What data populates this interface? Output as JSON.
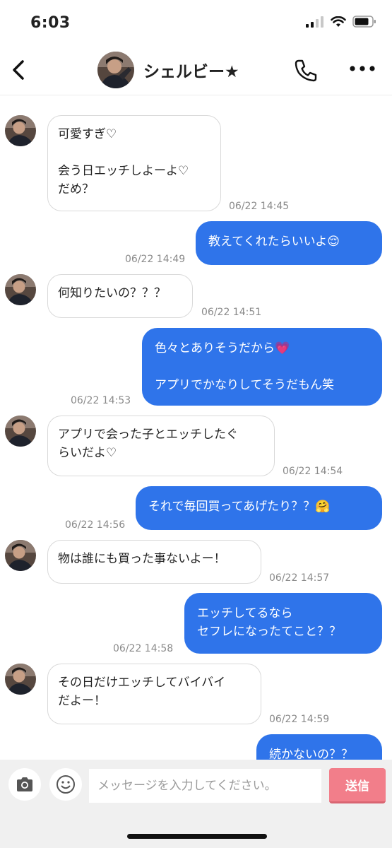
{
  "status": {
    "time": "6:03"
  },
  "header": {
    "name": "シェルビー★"
  },
  "messages": [
    {
      "text": "可愛すぎ♡\n\n会う日エッチしよーよ♡\nだめ？",
      "time": "06/22 14:45"
    },
    {
      "text": "教えてくれたらいいよ😌",
      "time": "06/22 14:49"
    },
    {
      "text": "何知りたいの？？？",
      "time": "06/22 14:51"
    },
    {
      "text": "色々とありそうだから💗\n\nアプリでかなりしてそうだもん笑",
      "time": "06/22 14:53"
    },
    {
      "text": "アプリで会った子とエッチしたぐ\nらいだよ♡",
      "time": "06/22 14:54"
    },
    {
      "text": "それで毎回買ってあげたり？？🤗",
      "time": "06/22 14:56"
    },
    {
      "text": "物は誰にも買った事ないよー！",
      "time": "06/22 14:57"
    },
    {
      "text": "エッチしてるなら\nセフレになったてこと？？",
      "time": "06/22 14:58"
    },
    {
      "text": "その日だけエッチしてバイバイ\nだよー！",
      "time": "06/22 14:59"
    },
    {
      "text": "続かないの？？",
      "time": ""
    }
  ],
  "input": {
    "placeholder": "メッセージを入力してください。",
    "send_label": "送信"
  },
  "colors": {
    "outgoing_bubble": "#2f74ea",
    "send_button": "#f27e8a"
  }
}
